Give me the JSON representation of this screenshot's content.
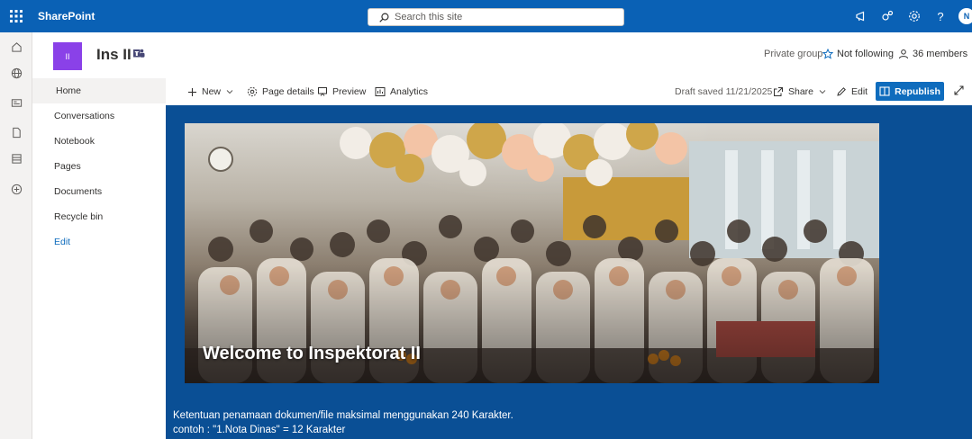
{
  "suitebar": {
    "brand": "SharePoint",
    "search_placeholder": "Search this site",
    "avatar_initial": "N"
  },
  "site": {
    "logo_text": "II",
    "title": "Ins II",
    "privacy": "Private group",
    "follow_label": "Not following",
    "members_label": "36 members"
  },
  "nav": {
    "items": [
      {
        "label": "Home"
      },
      {
        "label": "Conversations"
      },
      {
        "label": "Notebook"
      },
      {
        "label": "Pages"
      },
      {
        "label": "Documents"
      },
      {
        "label": "Recycle bin"
      }
    ],
    "edit_label": "Edit"
  },
  "commandbar": {
    "new_label": "New",
    "page_details_label": "Page details",
    "preview_label": "Preview",
    "analytics_label": "Analytics",
    "draft_status": "Draft saved 11/21/2025",
    "share_label": "Share",
    "edit_label": "Edit",
    "republish_label": "Republish"
  },
  "hero": {
    "title": "Welcome to Inspektorat II"
  },
  "content": {
    "note_line1": "Ketentuan penamaan dokumen/file maksimal menggunakan 240 Karakter.",
    "note_line2": "contoh : \"1.Nota Dinas\"  = 12 Karakter"
  },
  "colors": {
    "suitebar": "#0a61b5",
    "accent": "#0f6cbd",
    "canvas_bg": "#0a4f95",
    "site_logo": "#8a41e8"
  }
}
